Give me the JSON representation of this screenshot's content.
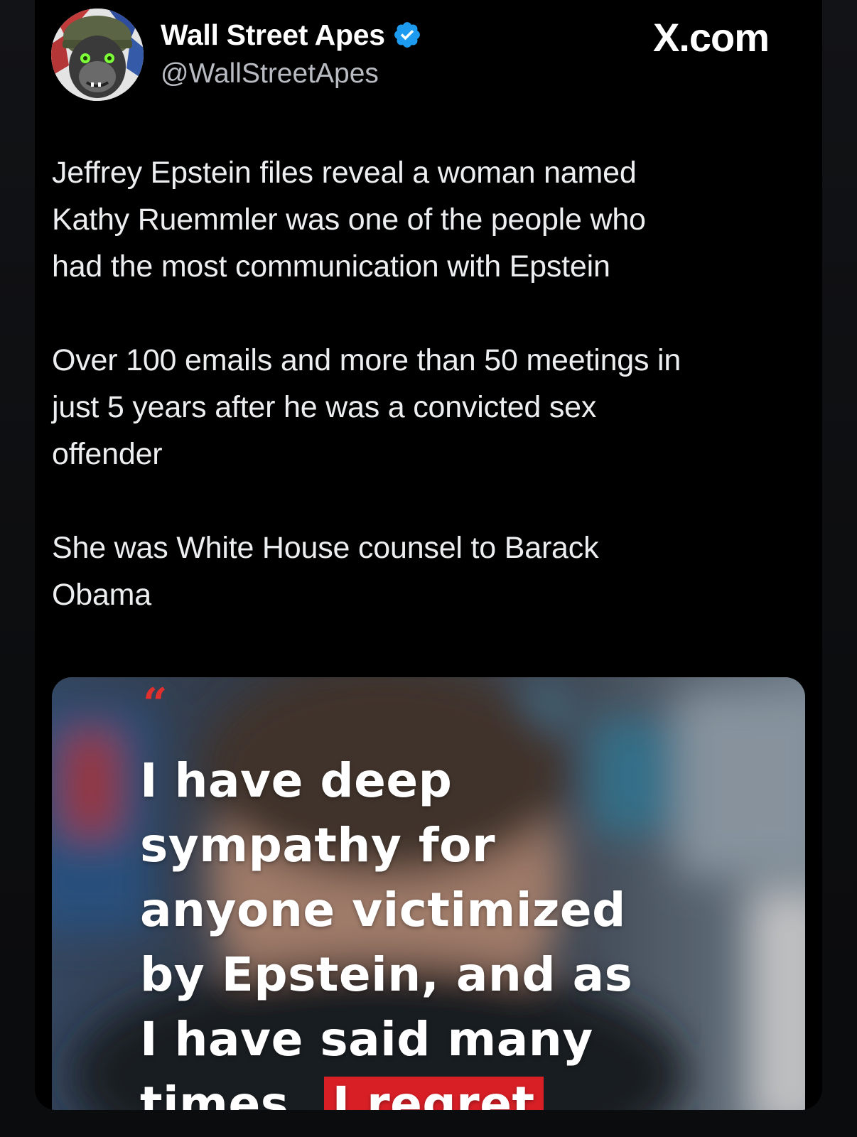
{
  "post": {
    "author": {
      "display_name": "Wall Street Apes",
      "handle": "@WallStreetApes",
      "verified": true
    },
    "brand": "X.com",
    "paragraphs": [
      {
        "lines": [
          "Jeffrey Epstein files reveal a woman named",
          "Kathy Ruemmler was one of the people who",
          "had the most communication with Epstein"
        ]
      },
      {
        "lines": [
          "Over 100 emails and more than 50 meetings in",
          "just 5 years after he was a convicted sex",
          "offender"
        ]
      },
      {
        "lines": [
          "She was White House counsel to Barack",
          "Obama"
        ]
      }
    ],
    "media": {
      "quote_mark": "“",
      "quote_lines": [
        "I have deep",
        "sympathy for",
        "anyone victimized",
        "by Epstein, and as",
        "I have said many"
      ],
      "quote_last_line": {
        "plain": "times.",
        "highlighted": "I regret"
      }
    }
  },
  "colors": {
    "background": "#000000",
    "text": "#eceef0",
    "secondary_text": "#b8bcc2",
    "verified_badge": "#1d9bf0",
    "quote_accent": "#d81f26"
  },
  "icons": {
    "verified": "verified-badge-icon",
    "brand": "x-logo-icon"
  }
}
